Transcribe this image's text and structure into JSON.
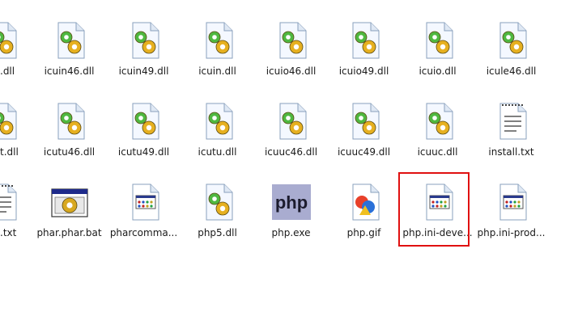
{
  "rows": [
    [
      {
        "label": ".dll",
        "icon": "dll-file-icon",
        "type": "dll"
      },
      {
        "label": "icuin46.dll",
        "icon": "dll-file-icon",
        "type": "dll"
      },
      {
        "label": "icuin49.dll",
        "icon": "dll-file-icon",
        "type": "dll"
      },
      {
        "label": "icuin.dll",
        "icon": "dll-file-icon",
        "type": "dll"
      },
      {
        "label": "icuio46.dll",
        "icon": "dll-file-icon",
        "type": "dll"
      },
      {
        "label": "icuio49.dll",
        "icon": "dll-file-icon",
        "type": "dll"
      },
      {
        "label": "icuio.dll",
        "icon": "dll-file-icon",
        "type": "dll"
      },
      {
        "label": "icule46.dll",
        "icon": "dll-file-icon",
        "type": "dll"
      }
    ],
    [
      {
        "label": "t.dll",
        "icon": "dll-file-icon",
        "type": "dll"
      },
      {
        "label": "icutu46.dll",
        "icon": "dll-file-icon",
        "type": "dll"
      },
      {
        "label": "icutu49.dll",
        "icon": "dll-file-icon",
        "type": "dll"
      },
      {
        "label": "icutu.dll",
        "icon": "dll-file-icon",
        "type": "dll"
      },
      {
        "label": "icuuc46.dll",
        "icon": "dll-file-icon",
        "type": "dll"
      },
      {
        "label": "icuuc49.dll",
        "icon": "dll-file-icon",
        "type": "dll"
      },
      {
        "label": "icuuc.dll",
        "icon": "dll-file-icon",
        "type": "dll"
      },
      {
        "label": "install.txt",
        "icon": "notepad-file-icon",
        "type": "txt"
      }
    ],
    [
      {
        "label": ".txt",
        "icon": "text-file-icon",
        "type": "txt"
      },
      {
        "label": "phar.phar.bat",
        "icon": "batch-file-icon",
        "type": "bat"
      },
      {
        "label": "pharcomma...",
        "icon": "config-file-icon",
        "type": "ini"
      },
      {
        "label": "php5.dll",
        "icon": "dll-file-icon",
        "type": "dll"
      },
      {
        "label": "php.exe",
        "icon": "php-exe-icon",
        "type": "php"
      },
      {
        "label": "php.gif",
        "icon": "image-file-icon",
        "type": "gif"
      },
      {
        "label": "php.ini-deve...",
        "icon": "config-file-icon",
        "type": "ini"
      },
      {
        "label": "php.ini-prod...",
        "icon": "config-file-icon",
        "type": "ini"
      }
    ]
  ],
  "highlight": {
    "label": "php.ini-deve...",
    "color": "#e01010"
  }
}
